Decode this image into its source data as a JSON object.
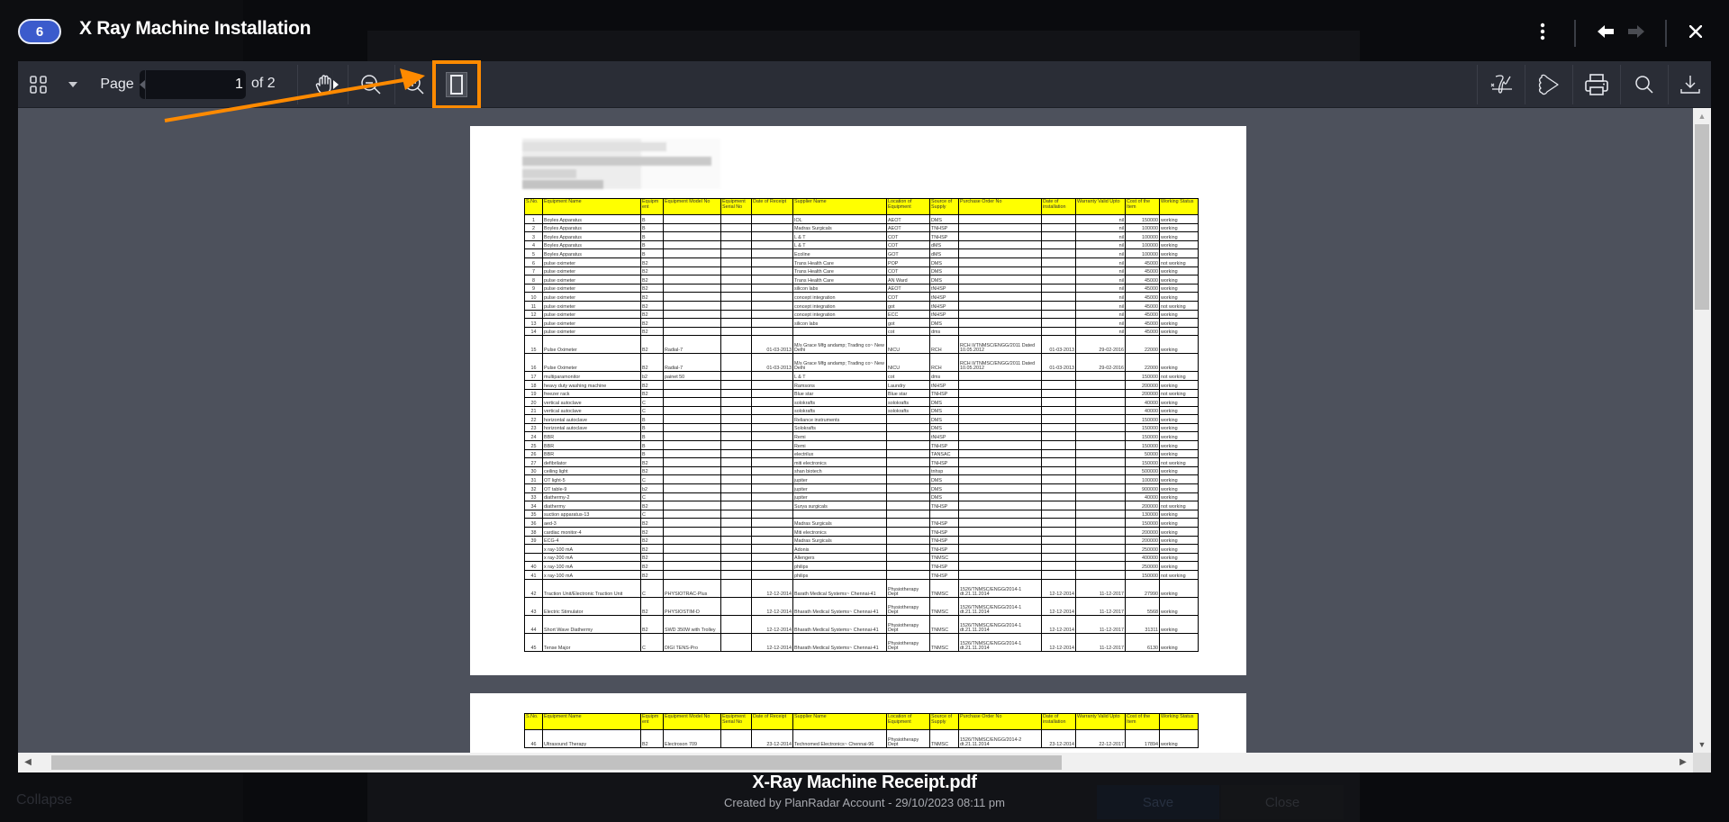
{
  "header": {
    "count_badge": "6",
    "title": "X Ray Machine Installation",
    "more_icon": "more-vertical-icon",
    "back_icon": "arrow-left-icon",
    "forward_icon": "arrow-right-icon",
    "close_icon": "close-icon"
  },
  "toolbar": {
    "thumbnails_icon": "grid-thumbnails-icon",
    "dropdown_icon": "caret-down-icon",
    "page_label": "Page",
    "current_page": "1",
    "page_total_label": "of 2",
    "pan_icon": "hand-pan-icon",
    "zoom_out_icon": "zoom-out-icon",
    "zoom_in_icon": "zoom-in-icon",
    "single_page_icon": "single-page-view-icon",
    "right_tools": [
      {
        "name": "signature-icon"
      },
      {
        "name": "annotate-shape-icon"
      },
      {
        "name": "print-icon"
      },
      {
        "name": "search-icon"
      },
      {
        "name": "download-icon"
      }
    ]
  },
  "annotation": {
    "highlight_color": "#ff8a00"
  },
  "document": {
    "columns": [
      "S.No.",
      "Equipment Name",
      "Equipm ent",
      "Equipment Model No",
      "Equipment Serial No",
      "Date of Receipt",
      "Supplier Name",
      "Location of Equipment",
      "Source of Supply",
      "Purchase Order No",
      "Date of installation",
      "Warranty Valid Upto",
      "Cost of the Item",
      "Working Status"
    ],
    "page1_rows": [
      [
        "1",
        "Boyles Apparatus",
        "B",
        "",
        "",
        "",
        "IOL",
        "AEOT",
        "DMS",
        "",
        "",
        "nil",
        "150000",
        "working"
      ],
      [
        "2",
        "Boyles Apparatus",
        "B",
        "",
        "",
        "",
        "Madras Surgicals",
        "AEOT",
        "TNHSP",
        "",
        "",
        "nil",
        "100000",
        "working"
      ],
      [
        "3",
        "Boyles Apparatus",
        "B",
        "",
        "",
        "",
        "L & T",
        "COT",
        "TNHSP",
        "",
        "",
        "nil",
        "100000",
        "working"
      ],
      [
        "4",
        "Boyles Apparatus",
        "B",
        "",
        "",
        "",
        "L & T",
        "COT",
        "dMS",
        "",
        "",
        "nil",
        "100000",
        "working"
      ],
      [
        "5",
        "Boyles Apparatus",
        "B",
        "",
        "",
        "",
        "Ecoline",
        "GOT",
        "dMS",
        "",
        "",
        "nil",
        "100000",
        "working"
      ],
      [
        "6",
        "pulse oximeter",
        "B2",
        "",
        "",
        "",
        "Trans Health Care",
        "POP",
        "DMS",
        "",
        "",
        "nil",
        "45000",
        "not working"
      ],
      [
        "7",
        "pulse oximeter",
        "B2",
        "",
        "",
        "",
        "Trans Health Care",
        "COT",
        "DMS",
        "",
        "",
        "nil",
        "45000",
        "working"
      ],
      [
        "8",
        "pulse oximeter",
        "B2",
        "",
        "",
        "",
        "Trans Health Care",
        "AN Ward",
        "DMS",
        "",
        "",
        "nil",
        "45000",
        "working"
      ],
      [
        "9",
        "pulse oximeter",
        "B2",
        "",
        "",
        "",
        "silicon labs",
        "AEOT",
        "tNHSP",
        "",
        "",
        "nil",
        "45000",
        "working"
      ],
      [
        "10",
        "pulse oximeter",
        "B2",
        "",
        "",
        "",
        "concept integration",
        "COT",
        "tNHSP",
        "",
        "",
        "nil",
        "45000",
        "working"
      ],
      [
        "11",
        "pulse oximeter",
        "B2",
        "",
        "",
        "",
        "concept integration",
        "got",
        "tNHSP",
        "",
        "",
        "nil",
        "45000",
        "not working"
      ],
      [
        "12",
        "pulse oximeter",
        "B2",
        "",
        "",
        "",
        "concept integration",
        "ECC",
        "tNHSP",
        "",
        "",
        "nil",
        "45000",
        "working"
      ],
      [
        "13",
        "pulse oximeter",
        "B2",
        "",
        "",
        "",
        "silicon labs",
        "got",
        "DMS",
        "",
        "",
        "nil",
        "45000",
        "working"
      ],
      [
        "14",
        "pulse oximeter",
        "B2",
        "",
        "",
        "",
        "",
        "cot",
        "dms",
        "",
        "",
        "nil",
        "45000",
        "working"
      ],
      [
        "15",
        "Pulse Oximeter",
        "B2",
        "Radial-7",
        "",
        "01-03-2013",
        "M/s Grace Mfg andamp; Trading co~ New Delhi",
        "NICU",
        "RCH",
        "RCH II/TNMSC/ENGG/2011 Dated 10.05.2012",
        "01-03-2013",
        "29-02-2016",
        "22000",
        "working"
      ],
      [
        "16",
        "Pulse Oximeter",
        "B2",
        "Radial-7",
        "",
        "01-03-2013",
        "M/s Grace Mfg andamp; Trading co~ New Delhi",
        "NICU",
        "RCH",
        "RCH II/TNMSC/ENGG/2011 Dated 10.05.2012",
        "01-03-2013",
        "29-02-2016",
        "22000",
        "working"
      ],
      [
        "17",
        "multiparamonitor",
        "b2",
        "painet 50",
        "",
        "",
        "L & T",
        "cot",
        "dms",
        "",
        "",
        "",
        "150000",
        "not working"
      ],
      [
        "18",
        "heavy duty washing machine",
        "B2",
        "",
        "",
        "",
        "Ramsons",
        "Laundry",
        "tNHSP",
        "",
        "",
        "",
        "200000",
        "working"
      ],
      [
        "19",
        "freezer rack",
        "B2",
        "",
        "",
        "",
        "Blue star",
        "Blue star",
        "TNHSP",
        "",
        "",
        "",
        "200000",
        "not working"
      ],
      [
        "20",
        "vertical autoclave",
        "C",
        "",
        "",
        "",
        "solokrafts",
        "solokrafts",
        "DMS",
        "",
        "",
        "",
        "40000",
        "working"
      ],
      [
        "21",
        "vertical autoclave",
        "C",
        "",
        "",
        "",
        "solokrafts",
        "solokrafts",
        "DMS",
        "",
        "",
        "",
        "40000",
        "working"
      ],
      [
        "22",
        "horizontal autoclave",
        "B",
        "",
        "",
        "",
        "Reliance instruments",
        "",
        "DMS",
        "",
        "",
        "",
        "150000",
        "working"
      ],
      [
        "23",
        "horizontal autoclave",
        "B",
        "",
        "",
        "",
        "Solokrafts",
        "",
        "DMS",
        "",
        "",
        "",
        "150000",
        "working"
      ],
      [
        "24",
        "BBR",
        "B",
        "",
        "",
        "",
        "Remi",
        "",
        "tNHSP",
        "",
        "",
        "",
        "150000",
        "working"
      ],
      [
        "25",
        "BBR",
        "B",
        "",
        "",
        "",
        "Remi",
        "",
        "TNHSP",
        "",
        "",
        "",
        "150000",
        "working"
      ],
      [
        "26",
        "BBR",
        "B",
        "",
        "",
        "",
        "electrilux",
        "",
        "TANSAC",
        "",
        "",
        "",
        "50000",
        "working"
      ],
      [
        "27",
        "defibrilator",
        "B2",
        "",
        "",
        "",
        "miti electronics",
        "",
        "TNHSP",
        "",
        "",
        "",
        "150000",
        "not working"
      ],
      [
        "30",
        "ceiling light",
        "B2",
        "",
        "",
        "",
        "shan biotech",
        "",
        "tnhsp",
        "",
        "",
        "",
        "500000",
        "working"
      ],
      [
        "31",
        "OT light-5",
        "C",
        "",
        "",
        "",
        "jupiter",
        "",
        "DMS",
        "",
        "",
        "",
        "100000",
        "working"
      ],
      [
        "32",
        "OT table-9",
        "b2",
        "",
        "",
        "",
        "jupiter",
        "",
        "DMS",
        "",
        "",
        "",
        "900000",
        "working"
      ],
      [
        "33",
        "diathermy-2",
        "C",
        "",
        "",
        "",
        "jupiter",
        "",
        "DMS",
        "",
        "",
        "",
        "40000",
        "working"
      ],
      [
        "34",
        "diathermy",
        "B2",
        "",
        "",
        "",
        "Surya surgicals",
        "",
        "TNHSP",
        "",
        "",
        "",
        "200000",
        "not working"
      ],
      [
        "35",
        "suction apparatus-13",
        "C",
        "",
        "",
        "",
        "",
        "",
        "",
        "",
        "",
        "",
        "130000",
        "working"
      ],
      [
        "36",
        "aed-3",
        "B2",
        "",
        "",
        "",
        "Madras Surgicals",
        "",
        "TNHSP",
        "",
        "",
        "",
        "150000",
        "working"
      ],
      [
        "38",
        "cardiac monitor-4",
        "B2",
        "",
        "",
        "",
        "Miti electronics",
        "",
        "TNHSP",
        "",
        "",
        "",
        "200000",
        "working"
      ],
      [
        "39",
        "ECG-4",
        "B2",
        "",
        "",
        "",
        "Madras Surgicals",
        "",
        "TNHSP",
        "",
        "",
        "",
        "200000",
        "working"
      ],
      [
        "",
        "x ray-100 mA",
        "B2",
        "",
        "",
        "",
        "Adonis",
        "",
        "TNHSP",
        "",
        "",
        "",
        "250000",
        "working"
      ],
      [
        "",
        "x ray-200 mA",
        "B2",
        "",
        "",
        "",
        "Allengers",
        "",
        "TNMSC",
        "",
        "",
        "",
        "400000",
        "working"
      ],
      [
        "40",
        "x ray-100 mA",
        "B2",
        "",
        "",
        "",
        "philips",
        "",
        "TNHSP",
        "",
        "",
        "",
        "250000",
        "working"
      ],
      [
        "41",
        "x ray-100 mA",
        "B2",
        "",
        "",
        "",
        "philips",
        "",
        "TNHSP",
        "",
        "",
        "",
        "150000",
        "not working"
      ],
      [
        "42",
        "Traction Unit/Electronic Traction Unit",
        "C",
        "PHYSIOTRAC-Plus",
        "",
        "12-12-2014",
        "Barath Medical Systems~ Chennai-41",
        "Physiotherapy Dept",
        "TNMSC",
        "1526/TNMSC/ENGG/2014-1 dt.21.11.2014",
        "12-12-2014",
        "11-12-2017",
        "27990",
        "working"
      ],
      [
        "43",
        "Electric Stimulator",
        "B2",
        "PHYSIOSTIM-D",
        "",
        "12-12-2014",
        "Bharath Medical Systems~ Chennai-41",
        "Physiotherapy Dept",
        "TNMSC",
        "1526/TNMSC/ENGG/2014-1 dt.21.11.2014",
        "12-12-2014",
        "11-12-2017",
        "5568",
        "working"
      ],
      [
        "44",
        "Short Wave Diathermy",
        "B2",
        "SWD 350W with Trolley",
        "",
        "12-12-2014",
        "Bharath Medical Systems~ Chennai-41",
        "Physiotherapy Dept",
        "TNMSC",
        "1526/TNMSC/ENGG/2014-1 dt.21.11.2014",
        "12-12-2014",
        "11-12-2017",
        "31311",
        "working"
      ],
      [
        "45",
        "Tense Major",
        "C",
        "DIGI TENS-Pro",
        "",
        "12-12-2014",
        "Bharath Medical Systems~ Chennai-41",
        "Physiotherapy Dept",
        "TNMSC",
        "1526/TNMSC/ENGG/2014-1 dt.21.11.2014",
        "12-12-2014",
        "11-12-2017",
        "6130",
        "working"
      ]
    ],
    "page2_rows": [
      [
        "46",
        "Ultrasound Therapy",
        "B2",
        "Electroson 709",
        "",
        "23-12-2014",
        "Technomed Electronics~ Chennai-96",
        "Physiotherapy Dept",
        "TNMSC",
        "1526/TNMSC/ENGG/2014-2 dt.21.11.2014",
        "23-12-2014",
        "22-12-2017",
        "17894",
        "working"
      ]
    ]
  },
  "footer": {
    "file_name": "X-Ray Machine Receipt.pdf",
    "meta": "Created by PlanRadar Account - 29/10/2023 08:11 pm"
  },
  "background": {
    "collapse_label": "Collapse",
    "save_label": "Save",
    "close_label": "Close"
  }
}
